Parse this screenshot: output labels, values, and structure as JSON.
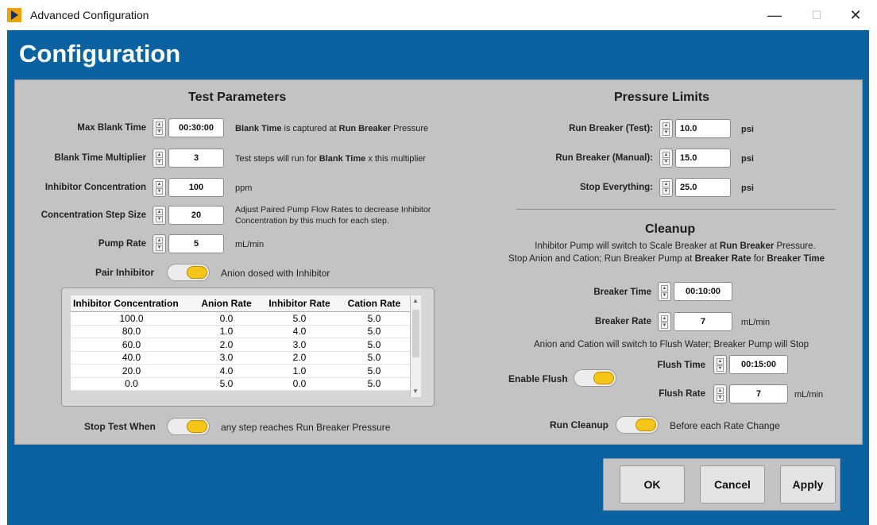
{
  "window": {
    "title": "Advanced Configuration",
    "minimize": "—",
    "maximize": "☐",
    "close": "✕"
  },
  "page_title": "Configuration",
  "test_parameters": {
    "heading": "Test Parameters",
    "max_blank_time": {
      "label": "Max Blank Time",
      "value": "00:30:00",
      "note_bold1": "Blank Time",
      "note_mid": " is captured at ",
      "note_bold2": "Run Breaker",
      "note_end": " Pressure"
    },
    "blank_time_multiplier": {
      "label": "Blank Time Multiplier",
      "value": "3",
      "note_start": "Test steps will run for ",
      "note_bold": "Blank Time",
      "note_end": " x this multiplier"
    },
    "inhibitor_concentration": {
      "label": "Inhibitor Concentration",
      "value": "100",
      "unit": "ppm"
    },
    "concentration_step_size": {
      "label": "Concentration Step Size",
      "value": "20",
      "note_line1": "Adjust Paired Pump Flow Rates to decrease Inhibitor",
      "note_line2": "Concentration by this much for each step."
    },
    "pump_rate": {
      "label": "Pump Rate",
      "value": "5",
      "unit": "mL/min"
    },
    "pair_inhibitor": {
      "label": "Pair Inhibitor",
      "note": "Anion dosed with Inhibitor"
    },
    "table": {
      "headers": [
        "Inhibitor Concentration",
        "Anion Rate",
        "Inhibitor Rate",
        "Cation Rate"
      ],
      "rows": [
        [
          "100.0",
          "0.0",
          "5.0",
          "5.0"
        ],
        [
          "80.0",
          "1.0",
          "4.0",
          "5.0"
        ],
        [
          "60.0",
          "2.0",
          "3.0",
          "5.0"
        ],
        [
          "40.0",
          "3.0",
          "2.0",
          "5.0"
        ],
        [
          "20.0",
          "4.0",
          "1.0",
          "5.0"
        ],
        [
          "0.0",
          "5.0",
          "0.0",
          "5.0"
        ]
      ]
    },
    "stop_test_when": {
      "label": "Stop Test When",
      "note": "any step reaches Run Breaker Pressure"
    }
  },
  "pressure_limits": {
    "heading": "Pressure Limits",
    "run_breaker_test": {
      "label": "Run Breaker (Test):",
      "value": "10.0",
      "unit": "psi"
    },
    "run_breaker_manual": {
      "label": "Run Breaker (Manual):",
      "value": "15.0",
      "unit": "psi"
    },
    "stop_everything": {
      "label": "Stop Everything:",
      "value": "25.0",
      "unit": "psi"
    }
  },
  "cleanup": {
    "heading": "Cleanup",
    "line1_start": "Inhibitor Pump will switch to Scale Breaker at ",
    "line1_bold": "Run Breaker",
    "line1_end": " Pressure.",
    "line2_start": "Stop Anion and Cation; Run Breaker Pump at ",
    "line2_bold1": "Breaker Rate",
    "line2_mid": " for ",
    "line2_bold2": "Breaker Time",
    "breaker_time": {
      "label": "Breaker Time",
      "value": "00:10:00"
    },
    "breaker_rate": {
      "label": "Breaker Rate",
      "value": "7",
      "unit": "mL/min"
    },
    "flush_note": "Anion and Cation will switch to Flush Water; Breaker Pump will Stop",
    "enable_flush": {
      "label": "Enable Flush"
    },
    "flush_time": {
      "label": "Flush Time",
      "value": "00:15:00"
    },
    "flush_rate": {
      "label": "Flush Rate",
      "value": "7",
      "unit": "mL/min"
    },
    "run_cleanup": {
      "label": "Run Cleanup",
      "note": "Before each Rate Change"
    }
  },
  "buttons": {
    "ok": "OK",
    "cancel": "Cancel",
    "apply": "Apply"
  },
  "colors": {
    "frame": "#0a63a0",
    "panel": "#c3c3c3",
    "toggle_knob": "#f5c518"
  }
}
